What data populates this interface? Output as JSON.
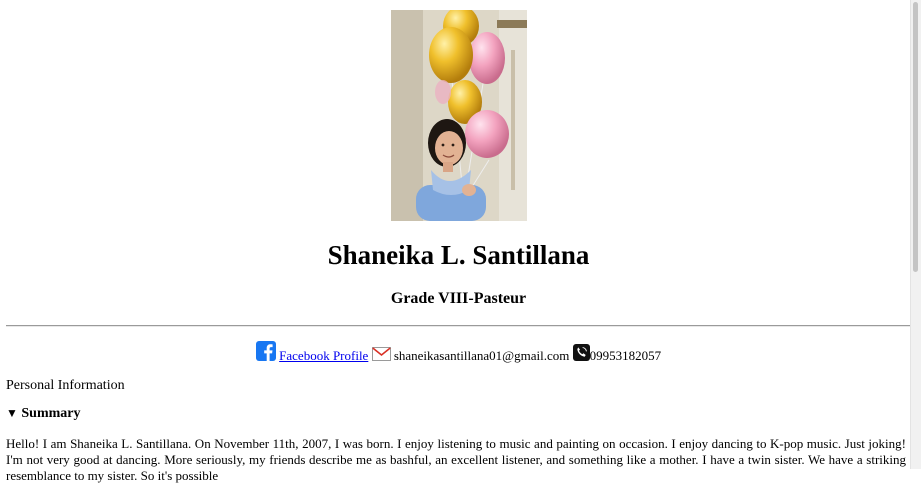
{
  "profile": {
    "name": "Shaneika L. Santillana",
    "grade": "Grade VIII-Pasteur"
  },
  "contact": {
    "facebook_icon": "facebook-icon",
    "facebook_label": "Facebook Profile",
    "email_icon": "mail-icon",
    "email": "shaneikasantillana01@gmail.com",
    "phone_icon": "phone-icon",
    "phone": "09953182057"
  },
  "section": {
    "label": "Personal Information"
  },
  "summary": {
    "toggle": "▼",
    "title": "Summary",
    "text": "Hello! I am Shaneika L. Santillana. On November 11th, 2007, I was born. I enjoy listening to music and painting on occasion. I enjoy dancing to K-pop music. Just joking! I'm not very good at dancing. More seriously, my friends describe me as bashful, an excellent listener, and something like a mother. I have a twin sister. We have a striking resemblance to my sister. So it's possible"
  },
  "colors": {
    "link": "#0000ee",
    "facebook": "#1877f2",
    "balloon_gold": "#e8b421",
    "balloon_pink": "#f3a3bf",
    "shirt": "#7fa7dc"
  }
}
